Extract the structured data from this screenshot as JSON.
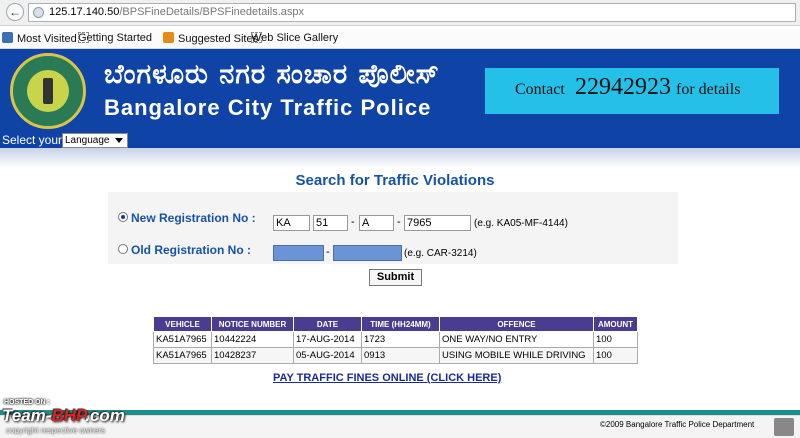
{
  "browser": {
    "url_host": "125.17.140.50",
    "url_path": "/BPSFineDetails/BPSFinedetails.aspx",
    "bookmarks": [
      "Most Visited",
      "Getting Started",
      "Suggested Sites",
      "Web Slice Gallery"
    ]
  },
  "header": {
    "title_kannada": "ಬೆಂಗಳೂರು ನಗರ ಸಂಚಾರ ಪೊಲೀಸ್",
    "title_english": "Bangalore City Traffic Police",
    "contact_prefix": "Contact",
    "contact_number": "22942923",
    "contact_suffix": "for details",
    "select_label": "Select your",
    "language_value": "Language"
  },
  "search": {
    "title": "Search for Traffic Violations",
    "new_label": "New Registration No :",
    "new_fields": [
      "KA",
      "51",
      "A",
      "7965"
    ],
    "new_example": "(e.g. KA05-MF-4144)",
    "old_label": "Old Registration No :",
    "old_example": "(e.g. CAR-3214)",
    "submit_label": "Submit",
    "selected_option": "new"
  },
  "results": {
    "columns": [
      "VEHICLE",
      "NOTICE NUMBER",
      "DATE",
      "TIME (HH24MM)",
      "OFFENCE",
      "AMOUNT"
    ],
    "rows": [
      [
        "KA51A7965",
        "10442224",
        "17-AUG-2014",
        "1723",
        "ONE WAY/NO ENTRY",
        "100"
      ],
      [
        "KA51A7965",
        "10428237",
        "05-AUG-2014",
        "0913",
        "USING MOBILE WHILE DRIVING",
        "100"
      ]
    ]
  },
  "pay_link": "PAY TRAFFIC FINES ONLINE (CLICK HERE)",
  "footer": {
    "copyright": "©2009 Bangalore Traffic Police Department"
  },
  "watermark": {
    "hosted": "HOSTED ON :",
    "brand_a": "Team-",
    "brand_b": "BHP",
    "brand_c": ".com",
    "sub": "copyright respective owners"
  },
  "colors": {
    "banner": "#0f43a6",
    "contact_box": "#25c0e8",
    "table_header": "#4a3d8f",
    "title_blue": "#1653a6"
  }
}
